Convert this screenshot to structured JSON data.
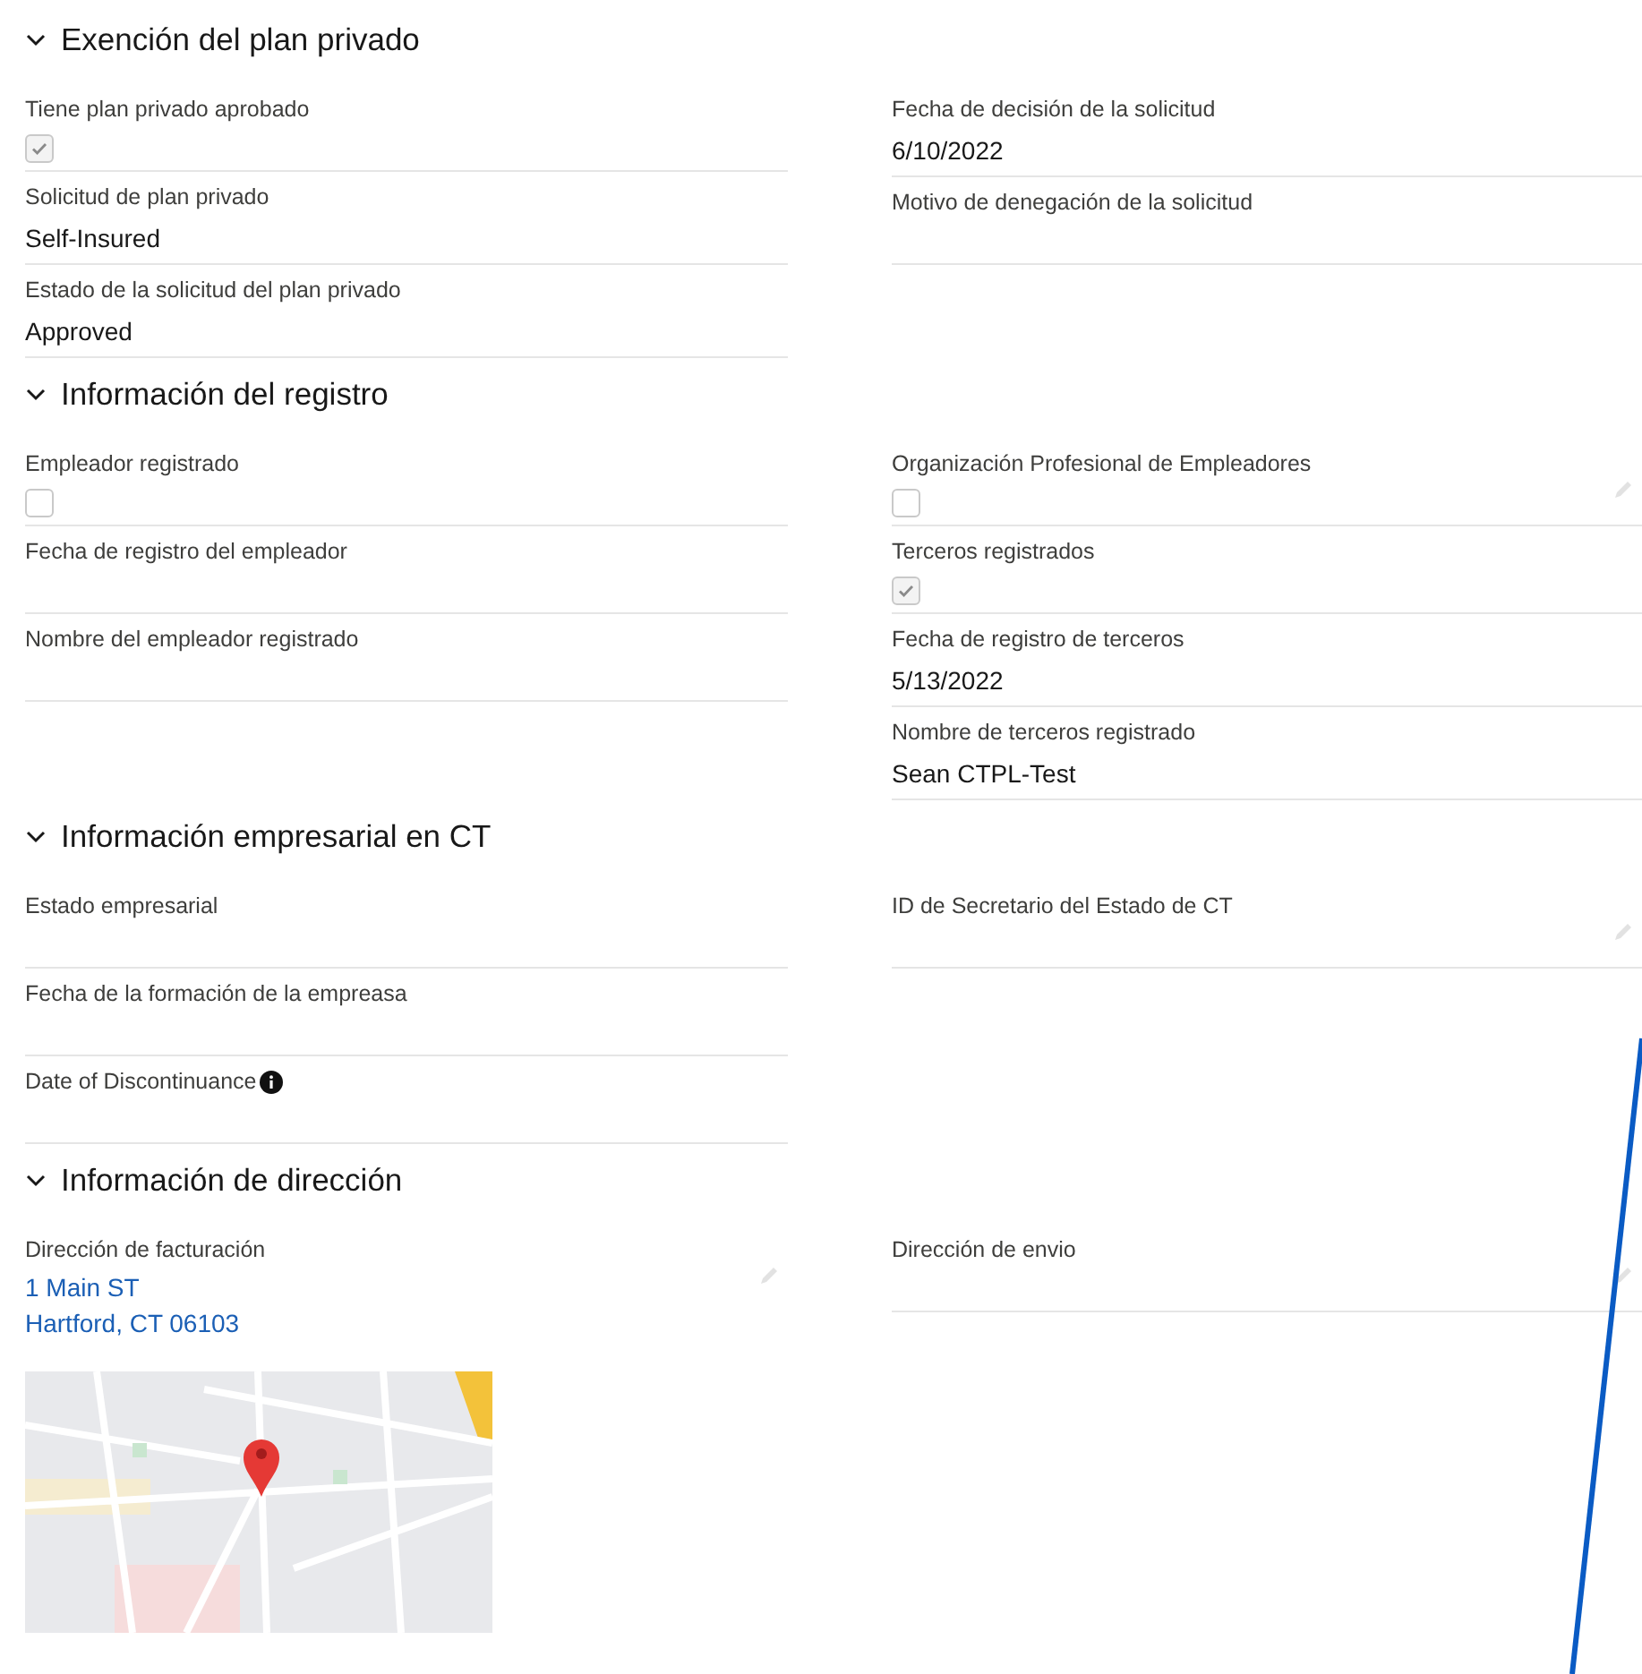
{
  "sections": [
    {
      "title": "Exención del plan privado",
      "expanded": true,
      "left": [
        {
          "kind": "checkbox",
          "label": "Tiene plan privado aprobado",
          "checked": true
        },
        {
          "kind": "text",
          "label": "Solicitud de plan privado",
          "value": "Self-Insured"
        },
        {
          "kind": "text",
          "label": "Estado de la solicitud del plan privado",
          "value": "Approved"
        }
      ],
      "right": [
        {
          "kind": "text",
          "label": "Fecha de decisión de la solicitud",
          "value": "6/10/2022"
        },
        {
          "kind": "text",
          "label": "Motivo de denegación de la solicitud"
        }
      ]
    },
    {
      "title": "Información del registro",
      "expanded": true,
      "left": [
        {
          "kind": "checkbox",
          "label": "Empleador registrado",
          "checked": false
        },
        {
          "kind": "text",
          "label": "Fecha de registro del empleador"
        },
        {
          "kind": "text",
          "label": "Nombre del empleador registrado"
        }
      ],
      "right": [
        {
          "kind": "checkbox",
          "label": "Organización Profesional de Empleadores",
          "checked": false,
          "editable": true
        },
        {
          "kind": "checkbox",
          "label": "Terceros registrados",
          "checked": true
        },
        {
          "kind": "text",
          "label": "Fecha de registro de terceros",
          "value": "5/13/2022"
        },
        {
          "kind": "text",
          "label": "Nombre de terceros registrado",
          "value": "Sean CTPL-Test"
        }
      ]
    },
    {
      "title": "Información empresarial en CT",
      "expanded": true,
      "left": [
        {
          "kind": "text",
          "label": "Estado empresarial"
        },
        {
          "kind": "text",
          "label": "Fecha de la formación de la empreasa"
        },
        {
          "kind": "text",
          "label": "Date of Discontinuance",
          "info": true
        }
      ],
      "right": [
        {
          "kind": "text",
          "label": "ID de Secretario del Estado de CT",
          "editable": true
        }
      ]
    },
    {
      "title": "Información de dirección",
      "expanded": true,
      "left": [
        {
          "kind": "address",
          "label": "Dirección de facturación",
          "lines": [
            "1 Main ST",
            "Hartford, CT 06103"
          ],
          "editable": true,
          "map": true
        }
      ],
      "right": [
        {
          "kind": "address",
          "label": "Dirección de envio",
          "editable": true
        }
      ]
    }
  ]
}
